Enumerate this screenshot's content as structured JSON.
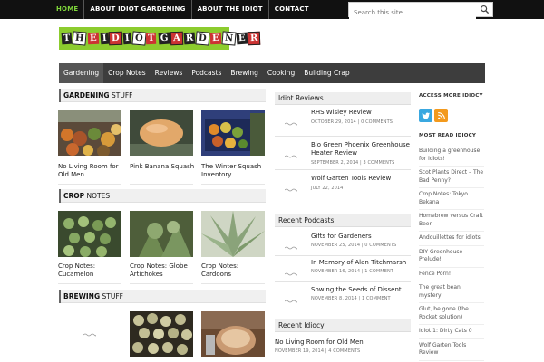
{
  "topnav": {
    "items": [
      "HOME",
      "ABOUT IDIOT GARDENING",
      "ABOUT THE IDIOT",
      "CONTACT"
    ],
    "search_placeholder": "Search this site"
  },
  "logo_text": "The Idiot Gardener",
  "mainnav": [
    "Gardening",
    "Crop Notes",
    "Reviews",
    "Podcasts",
    "Brewing",
    "Cooking",
    "Building Crap"
  ],
  "sections": {
    "gardening": {
      "bold": "GARDENING",
      "rest": "STUFF",
      "items": [
        "No Living Room for Old Men",
        "Pink Banana Squash",
        "The Winter Squash Inventory"
      ]
    },
    "crop": {
      "bold": "CROP",
      "rest": "NOTES",
      "items": [
        "Crop Notes: Cucamelon",
        "Crop Notes: Globe Artichokes",
        "Crop Notes: Cardoons"
      ]
    },
    "brewing": {
      "bold": "BREWING",
      "rest": "STUFF"
    }
  },
  "middle": {
    "reviews_title": "Idiot Reviews",
    "reviews": [
      {
        "title": "RHS Wisley Review",
        "meta": "OCTOBER 29, 2014 | 0 COMMENTS"
      },
      {
        "title": "Bio Green Phoenix Greenhouse Heater Review",
        "meta": "SEPTEMBER 2, 2014 | 3 COMMENTS"
      },
      {
        "title": "Wolf Garten Tools Review",
        "meta": "JULY 22, 2014"
      }
    ],
    "podcasts_title": "Recent Podcasts",
    "podcasts": [
      {
        "title": "Gifts for Gardeners",
        "meta": "NOVEMBER 25, 2014 | 0 COMMENTS"
      },
      {
        "title": "In Memory of Alan Titchmarsh",
        "meta": "NOVEMBER 16, 2014 | 1 COMMENT"
      },
      {
        "title": "Sowing the Seeds of Dissent",
        "meta": "NOVEMBER 8, 2014 | 1 COMMENT"
      }
    ],
    "recent_title": "Recent Idiocy",
    "recent": [
      {
        "title": "No Living Room for Old Men",
        "meta": "NOVEMBER 19, 2014 | 4 COMMENTS"
      }
    ]
  },
  "sidebar": {
    "access_title": "ACCESS MORE IDIOCY",
    "most_read_title": "MOST READ IDIOCY",
    "most_read": [
      "Building a greenhouse for idiots!",
      "Scot Plants Direct – The Bad Penny?",
      "Crop Notes: Tokyo Bekana",
      "Homebrew versus Craft Beer",
      "Andouillettes for idiots",
      "DIY Greenhouse Prelude!",
      "Fence Porn!",
      "The great bean mystery",
      "Glut, be gone (the Rocket solution)",
      "Idiot 1: Dirty Cats 0",
      "Wolf Garten Tools Review"
    ]
  },
  "colors": {
    "accent": "#7ed43a",
    "logo_bg": "#8ccc2e",
    "nav_bg": "#3d3d3d",
    "twitter": "#3aa8e0",
    "rss": "#f39a1d"
  }
}
